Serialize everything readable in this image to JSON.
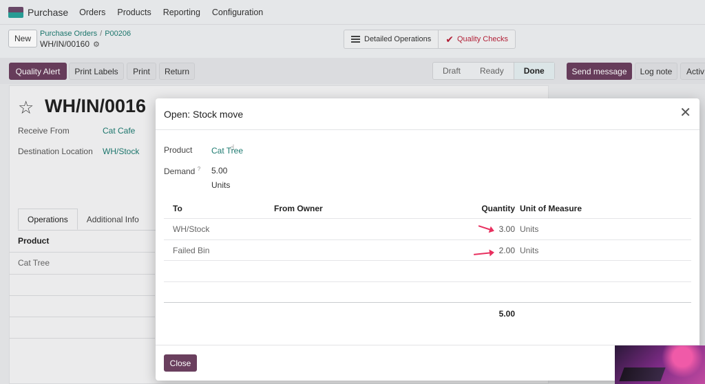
{
  "nav": {
    "app_name": "Purchase",
    "items": [
      "Orders",
      "Products",
      "Reporting",
      "Configuration"
    ]
  },
  "control": {
    "new_label": "New",
    "breadcrumb_parent": "Purchase Orders",
    "breadcrumb_order": "P00206",
    "record_ref": "WH/IN/00160",
    "detailed_ops_label": "Detailed Operations",
    "quality_checks_label": "Quality Checks"
  },
  "actions": {
    "quality_alert": "Quality Alert",
    "print_labels": "Print Labels",
    "print": "Print",
    "return": "Return",
    "status_steps": [
      "Draft",
      "Ready",
      "Done"
    ],
    "status_current": "Done"
  },
  "chatter": {
    "send_message": "Send message",
    "log_note": "Log note",
    "activities": "Activ"
  },
  "form": {
    "title": "WH/IN/0016",
    "receive_from_label": "Receive From",
    "receive_from_value": "Cat Cafe",
    "destination_label": "Destination Location",
    "destination_value": "WH/Stock",
    "tabs": [
      "Operations",
      "Additional Info"
    ],
    "grid_header": "Product",
    "grid_row": "Cat Tree"
  },
  "dialog": {
    "title": "Open: Stock move",
    "product_label": "Product",
    "product_value": "Cat Tree",
    "demand_label": "Demand",
    "demand_help": "?",
    "demand_value": "5.00",
    "demand_unit": "Units",
    "columns": {
      "to": "To",
      "from_owner": "From Owner",
      "quantity": "Quantity",
      "uom": "Unit of Measure"
    },
    "rows": [
      {
        "to": "WH/Stock",
        "quantity": "3.00",
        "uom": "Units"
      },
      {
        "to": "Failed Bin",
        "quantity": "2.00",
        "uom": "Units"
      }
    ],
    "total_quantity": "5.00",
    "close_label": "Close"
  },
  "colors": {
    "primary": "#6a3f5e",
    "link": "#1d7a70",
    "annotation_arrow": "#e8305f",
    "quality_checks": "#b8223a"
  }
}
